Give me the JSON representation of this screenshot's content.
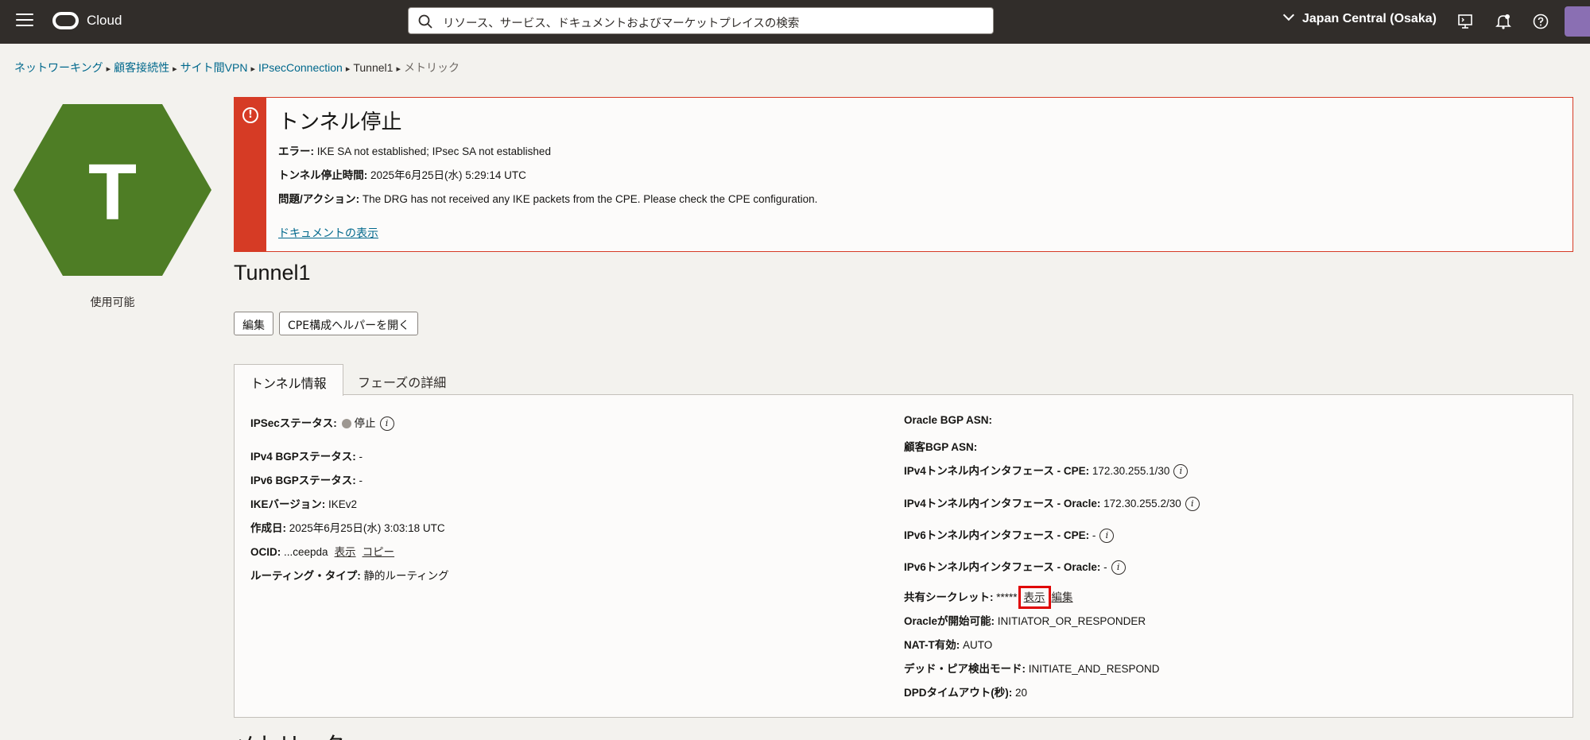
{
  "topbar": {
    "brand": "Cloud",
    "search_placeholder": "リソース、サービス、ドキュメントおよびマーケットプレイスの検索",
    "region": "Japan Central (Osaka)",
    "icons": [
      "menu-icon",
      "oracle-logo-icon",
      "search-icon",
      "chevron-down-icon",
      "cloud-shell-icon",
      "bell-icon",
      "help-icon",
      "profile-icon"
    ]
  },
  "breadcrumb": {
    "items": [
      "ネットワーキング",
      "顧客接続性",
      "サイト間VPN",
      "IPsecConnection",
      "Tunnel1",
      "メトリック"
    ]
  },
  "resource": {
    "letter": "T",
    "status": "使用可能",
    "hex_color": "#4e7d25"
  },
  "alert": {
    "title": "トンネル停止",
    "error_label": "エラー:",
    "error_value": "IKE SA not established; IPsec SA not established",
    "down_time_label": "トンネル停止時間:",
    "down_time_value": "2025年6月25日(水) 5:29:14 UTC",
    "action_label": "問題/アクション:",
    "action_value": "The DRG has not received any IKE packets from the CPE. Please check the CPE configuration.",
    "doc_link": "ドキュメントの表示",
    "color": "#d63b25"
  },
  "page": {
    "title": "Tunnel1",
    "edit_button": "編集",
    "cpe_button": "CPE構成ヘルパーを開く",
    "tabs": [
      "トンネル情報",
      "フェーズの詳細"
    ],
    "section_title": "メトリック"
  },
  "left_fields": {
    "ipsec_status_label": "IPSecステータス:",
    "ipsec_status_value": "停止",
    "ipv4_bgp_label": "IPv4 BGPステータス:",
    "ipv4_bgp_value": "-",
    "ipv6_bgp_label": "IPv6 BGPステータス:",
    "ipv6_bgp_value": "-",
    "ike_label": "IKEバージョン:",
    "ike_value": "IKEv2",
    "created_label": "作成日:",
    "created_value": "2025年6月25日(水) 3:03:18 UTC",
    "ocid_label": "OCID:",
    "ocid_value": "...ceepda",
    "ocid_show": "表示",
    "ocid_copy": "コピー",
    "routing_label": "ルーティング・タイプ:",
    "routing_value": "静的ルーティング"
  },
  "right_fields": {
    "oracle_asn_label": "Oracle BGP ASN:",
    "customer_asn_label": "顧客BGP ASN:",
    "ipv4_cpe_label": "IPv4トンネル内インタフェース - CPE:",
    "ipv4_cpe_value": "172.30.255.1/30",
    "ipv4_oracle_label": "IPv4トンネル内インタフェース - Oracle:",
    "ipv4_oracle_value": "172.30.255.2/30",
    "ipv6_cpe_label": "IPv6トンネル内インタフェース - CPE:",
    "ipv6_cpe_value": "-",
    "ipv6_oracle_label": "IPv6トンネル内インタフェース - Oracle:",
    "ipv6_oracle_value": "-",
    "secret_label": "共有シークレット:",
    "secret_value": "*****",
    "secret_show": "表示",
    "secret_edit": "編集",
    "initiator_label": "Oracleが開始可能:",
    "initiator_value": "INITIATOR_OR_RESPONDER",
    "natt_label": "NAT-T有効:",
    "natt_value": "AUTO",
    "dpd_mode_label": "デッド・ピア検出モード:",
    "dpd_mode_value": "INITIATE_AND_RESPOND",
    "dpd_timeout_label": "DPDタイムアウト(秒):",
    "dpd_timeout_value": "20"
  }
}
